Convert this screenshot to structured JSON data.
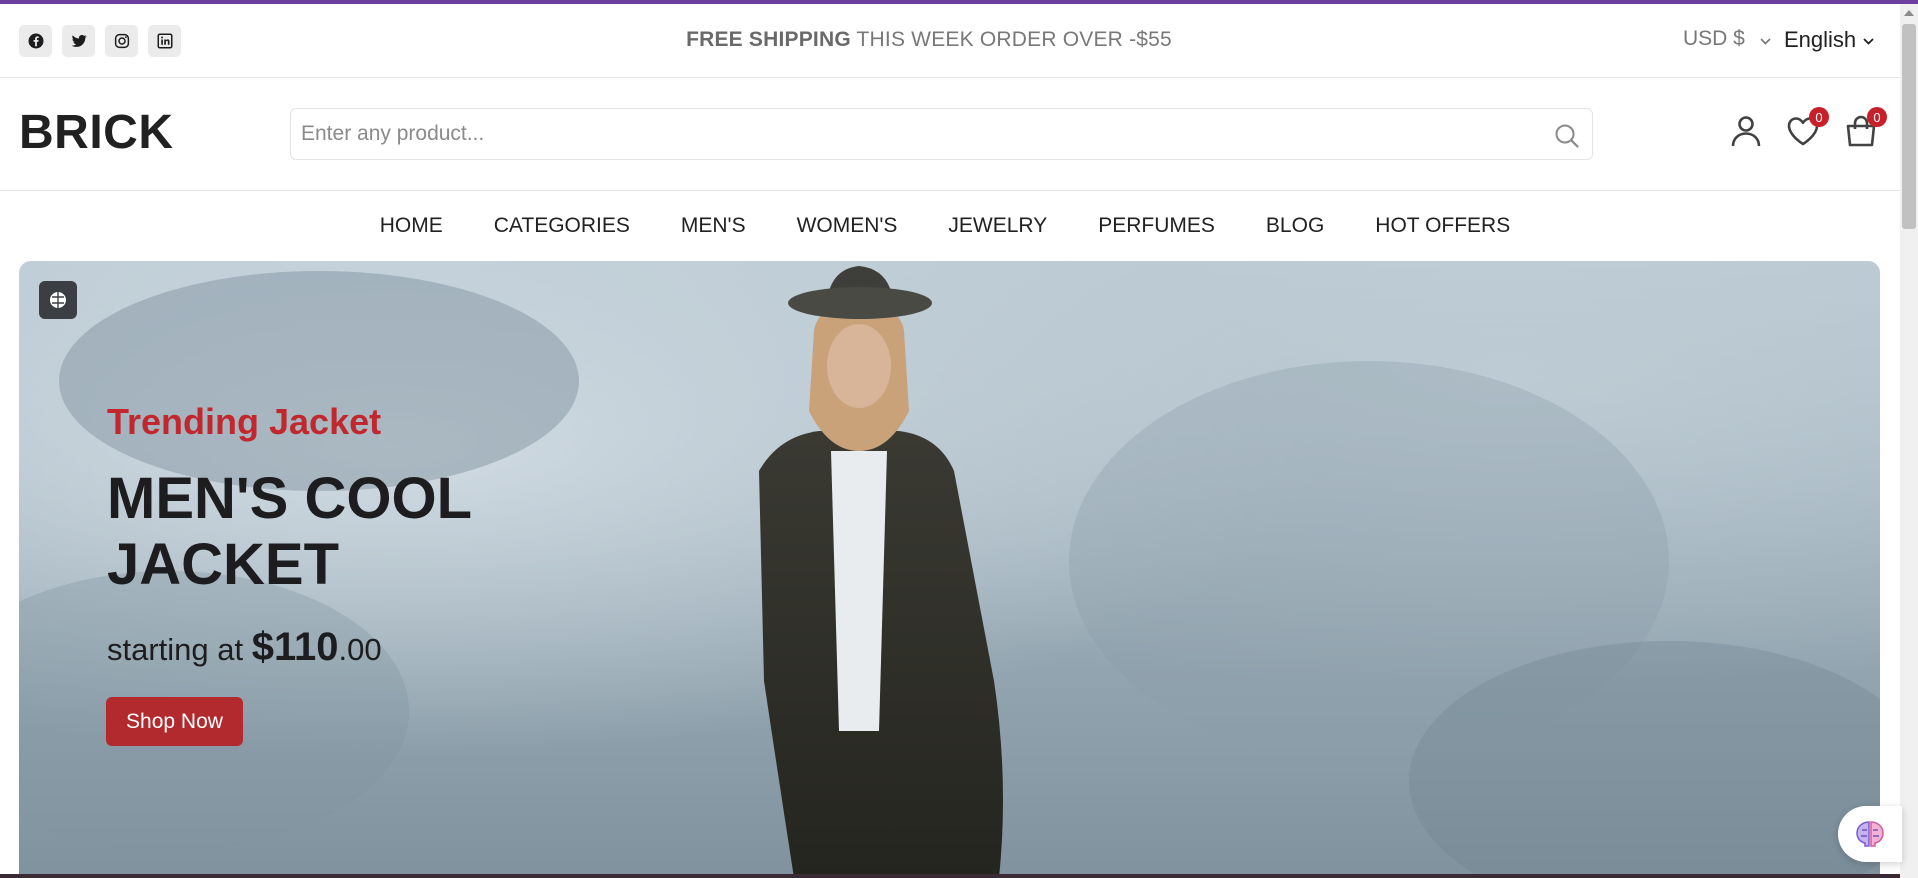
{
  "topbar": {
    "socials": [
      "facebook-icon",
      "twitter-icon",
      "instagram-icon",
      "linkedin-icon"
    ],
    "shipping_bold": "FREE SHIPPING",
    "shipping_rest": " THIS WEEK ORDER OVER -$55",
    "currency": "USD $",
    "language": "English"
  },
  "header": {
    "logo": "BRICK",
    "search_placeholder": "Enter any product...",
    "wishlist_count": "0",
    "cart_count": "0"
  },
  "nav": {
    "items": [
      "HOME",
      "CATEGORIES",
      "MEN'S",
      "WOMEN'S",
      "JEWELRY",
      "PERFUMES",
      "BLOG",
      "HOT OFFERS"
    ]
  },
  "hero": {
    "subtitle": "Trending Jacket",
    "title": "MEN'S COOL JACKET",
    "price_prefix": "starting at ",
    "price_main": "$110",
    "price_cents": ".00",
    "cta": "Shop Now"
  },
  "colors": {
    "accent": "#6f3fa0",
    "brand_red": "#c1272d",
    "button_red": "#b32a2e",
    "badge_red": "#c8202a"
  }
}
